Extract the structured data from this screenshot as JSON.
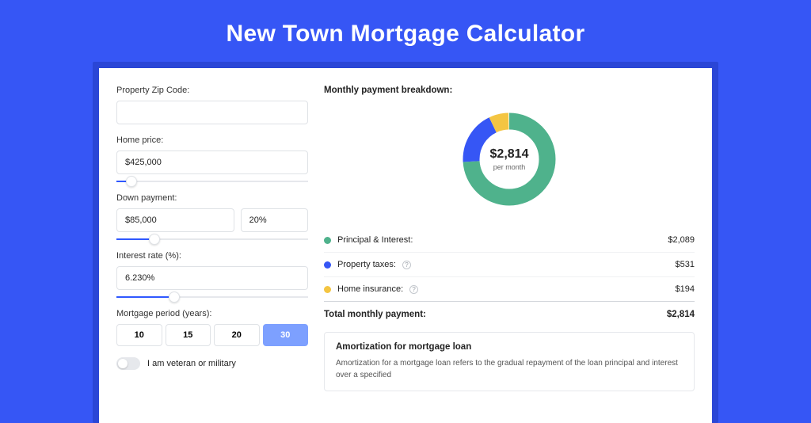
{
  "title": "New Town Mortgage Calculator",
  "form": {
    "zip_label": "Property Zip Code:",
    "zip_value": "",
    "price_label": "Home price:",
    "price_value": "$425,000",
    "price_slider_pct": 8,
    "down_label": "Down payment:",
    "down_value": "$85,000",
    "down_pct_value": "20%",
    "down_slider_pct": 20,
    "rate_label": "Interest rate (%):",
    "rate_value": "6.230%",
    "rate_slider_pct": 30,
    "period_label": "Mortgage period (years):",
    "periods": [
      "10",
      "15",
      "20",
      "30"
    ],
    "period_active": 3,
    "veteran_label": "I am veteran or military"
  },
  "breakdown": {
    "heading": "Monthly payment breakdown:",
    "center_value": "$2,814",
    "center_sub": "per month",
    "items": [
      {
        "color": "green",
        "label": "Principal & Interest:",
        "value": "$2,089",
        "help": false
      },
      {
        "color": "blue",
        "label": "Property taxes:",
        "value": "$531",
        "help": true
      },
      {
        "color": "yellow",
        "label": "Home insurance:",
        "value": "$194",
        "help": true
      }
    ],
    "total_label": "Total monthly payment:",
    "total_value": "$2,814"
  },
  "amort": {
    "heading": "Amortization for mortgage loan",
    "text": "Amortization for a mortgage loan refers to the gradual repayment of the loan principal and interest over a specified"
  },
  "chart_data": {
    "type": "pie",
    "title": "Monthly payment breakdown",
    "series": [
      {
        "name": "Principal & Interest",
        "value": 2089,
        "color": "#4fb28c"
      },
      {
        "name": "Property taxes",
        "value": 531,
        "color": "#3656f5"
      },
      {
        "name": "Home insurance",
        "value": 194,
        "color": "#f4c542"
      }
    ],
    "total": 2814
  }
}
